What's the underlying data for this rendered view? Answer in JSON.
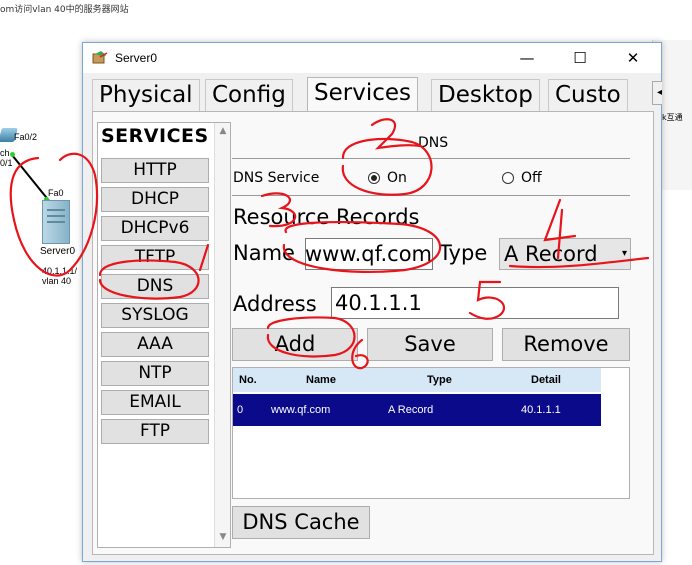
{
  "caption": "om访问vlan 40中的服务器网站",
  "canvas": {
    "switch_port_fa02": "Fa0/2",
    "switch_label_partial": "ch",
    "switch_port_partial": "0/1",
    "server_port": "Fa0",
    "server_name": "Server0",
    "server_ip": "40.1.1.1/",
    "server_vlan": "vlan 40"
  },
  "bg_right_text": "k互通",
  "window": {
    "title": "Server0",
    "minimize": "—",
    "maximize": "☐",
    "close": "✕",
    "tabs": [
      "Physical",
      "Config",
      "Services",
      "Desktop",
      "Custo"
    ],
    "active_tab": "Services",
    "tab_scroll": "◂▸"
  },
  "services": {
    "heading": "SERVICES",
    "items": [
      "HTTP",
      "DHCP",
      "DHCPv6",
      "TFTP",
      "DNS",
      "SYSLOG",
      "AAA",
      "NTP",
      "EMAIL",
      "FTP"
    ],
    "selected": "DNS"
  },
  "dns": {
    "section_title": "DNS",
    "service_label": "DNS Service",
    "on_label": "On",
    "off_label": "Off",
    "service_state": "On",
    "resource_records_title": "Resource Records",
    "name_label": "Name",
    "name_value": "www.qf.com",
    "type_label": "Type",
    "type_value": "A Record",
    "address_label": "Address",
    "address_value": "40.1.1.1",
    "add_button": "Add",
    "save_button": "Save",
    "remove_button": "Remove",
    "dns_cache_button": "DNS Cache",
    "table": {
      "headers": [
        "No.",
        "Name",
        "Type",
        "Detail"
      ],
      "rows": [
        {
          "no": "0",
          "name": "www.qf.com",
          "type": "A Record",
          "detail": "40.1.1.1"
        }
      ]
    }
  },
  "annotations": [
    "1",
    "2",
    "3",
    "4",
    "5",
    "6"
  ],
  "colors": {
    "annotation_red": "#e8141b",
    "selected_row": "#0a0a8a",
    "table_header": "#d6e7f5",
    "window_border": "#7aa7d8"
  }
}
